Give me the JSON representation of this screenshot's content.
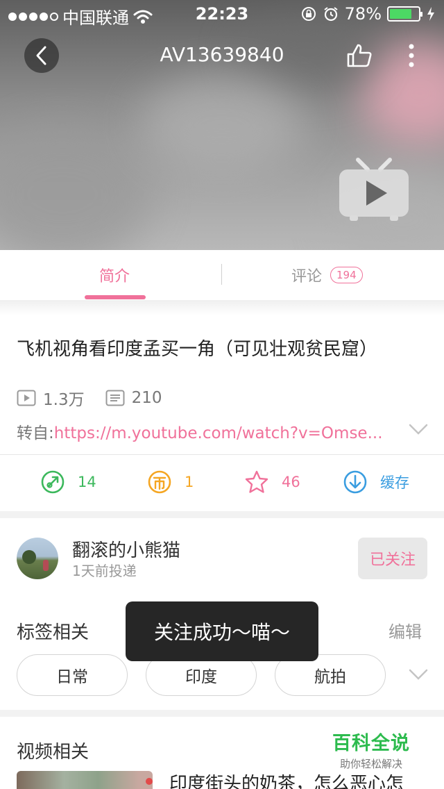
{
  "status_bar": {
    "carrier": "中国联通",
    "time": "22:23",
    "battery": "78%",
    "battery_level": 0.78
  },
  "nav": {
    "title": "AV13639840"
  },
  "tabs": {
    "intro_label": "简介",
    "comments_label": "评论",
    "comments_count": "194"
  },
  "video": {
    "title": "飞机视角看印度孟买一角（可见壮观贫民窟）",
    "views": "1.3万",
    "danmaku": "210",
    "source_prefix": "转自:",
    "source_link": "https://m.youtube.com/watch?v=Omse..."
  },
  "actions": {
    "share_count": "14",
    "coin_count": "1",
    "favorite_count": "46",
    "download_label": "缓存"
  },
  "uploader": {
    "name": "翻滚的小熊猫",
    "time": "1天前投递",
    "follow_label": "已关注"
  },
  "tags": {
    "heading": "标签相关",
    "edit_label": "编辑",
    "items": [
      "日常",
      "印度",
      "航拍"
    ]
  },
  "toast": {
    "message": "关注成功～喵～"
  },
  "related": {
    "heading": "视频相关",
    "first_title": "印度街头的奶茶，怎么恶心怎"
  },
  "watermark": {
    "main": "百科全说",
    "sub": "助你轻松解决"
  },
  "colors": {
    "accent_pink": "#f0719a",
    "share_green": "#3cb85c",
    "coin_orange": "#f5a623",
    "download_blue": "#3a9de0"
  }
}
